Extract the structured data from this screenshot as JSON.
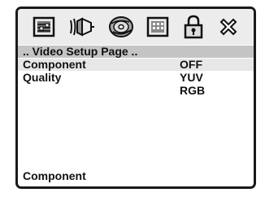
{
  "toolbar": {
    "icons": [
      "general-setup-icon",
      "audio-speaker-icon",
      "disc-icon",
      "video-screen-icon",
      "lock-icon",
      "close-icon"
    ]
  },
  "page": {
    "title": ".. Video Setup Page .."
  },
  "settings": [
    {
      "label": "Component",
      "value": "OFF"
    },
    {
      "label": "Quality"
    }
  ],
  "options": [
    "OFF",
    "YUV",
    "RGB"
  ],
  "status": {
    "text": "Component"
  },
  "colors": {
    "frame": "#1a1a1a",
    "toolbar": "#ececec",
    "titlebar": "#c4c4c4",
    "selected_row": "#e7e7e7",
    "text": "#111111"
  }
}
